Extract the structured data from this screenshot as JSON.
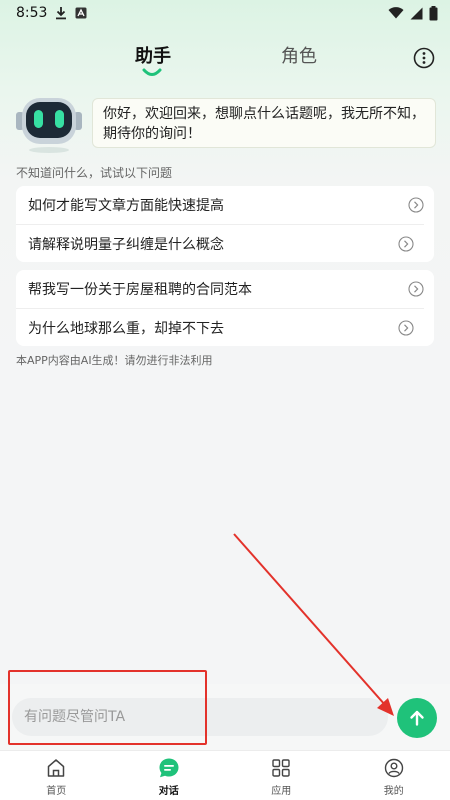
{
  "status_bar": {
    "time": "8:53",
    "icons": [
      "download-icon",
      "notification-a-icon",
      "wifi-icon",
      "signal-icon",
      "battery-icon"
    ]
  },
  "top_tabs": {
    "items": [
      {
        "label": "助手",
        "active": true
      },
      {
        "label": "角色",
        "active": false
      }
    ],
    "more_icon": "more-circle-icon"
  },
  "greeting": {
    "avatar_icon": "robot-avatar-icon",
    "message": "你好，欢迎回来，想聊点什么话题呢，我无所不知，期待你的询问！"
  },
  "suggestions": {
    "hint": "不知道问什么，试试以下问题",
    "groups": [
      {
        "items": [
          "如何才能写文章方面能快速提高",
          "请解释说明量子纠缠是什么概念"
        ]
      },
      {
        "items": [
          "帮我写一份关于房屋租聘的合同范本",
          "为什么地球那么重，却掉不下去"
        ]
      }
    ]
  },
  "disclaimer": "本APP内容由AI生成！请勿进行非法利用",
  "input": {
    "placeholder": "有问题尽管问TA",
    "value": "",
    "send_icon": "arrow-up-icon"
  },
  "bottom_nav": {
    "items": [
      {
        "label": "首页",
        "icon": "home-icon",
        "active": false
      },
      {
        "label": "对话",
        "icon": "chat-icon",
        "active": true
      },
      {
        "label": "应用",
        "icon": "apps-grid-icon",
        "active": false
      },
      {
        "label": "我的",
        "icon": "profile-icon",
        "active": false
      }
    ]
  },
  "colors": {
    "accent": "#1fc27a",
    "annotation": "#e3322b"
  }
}
